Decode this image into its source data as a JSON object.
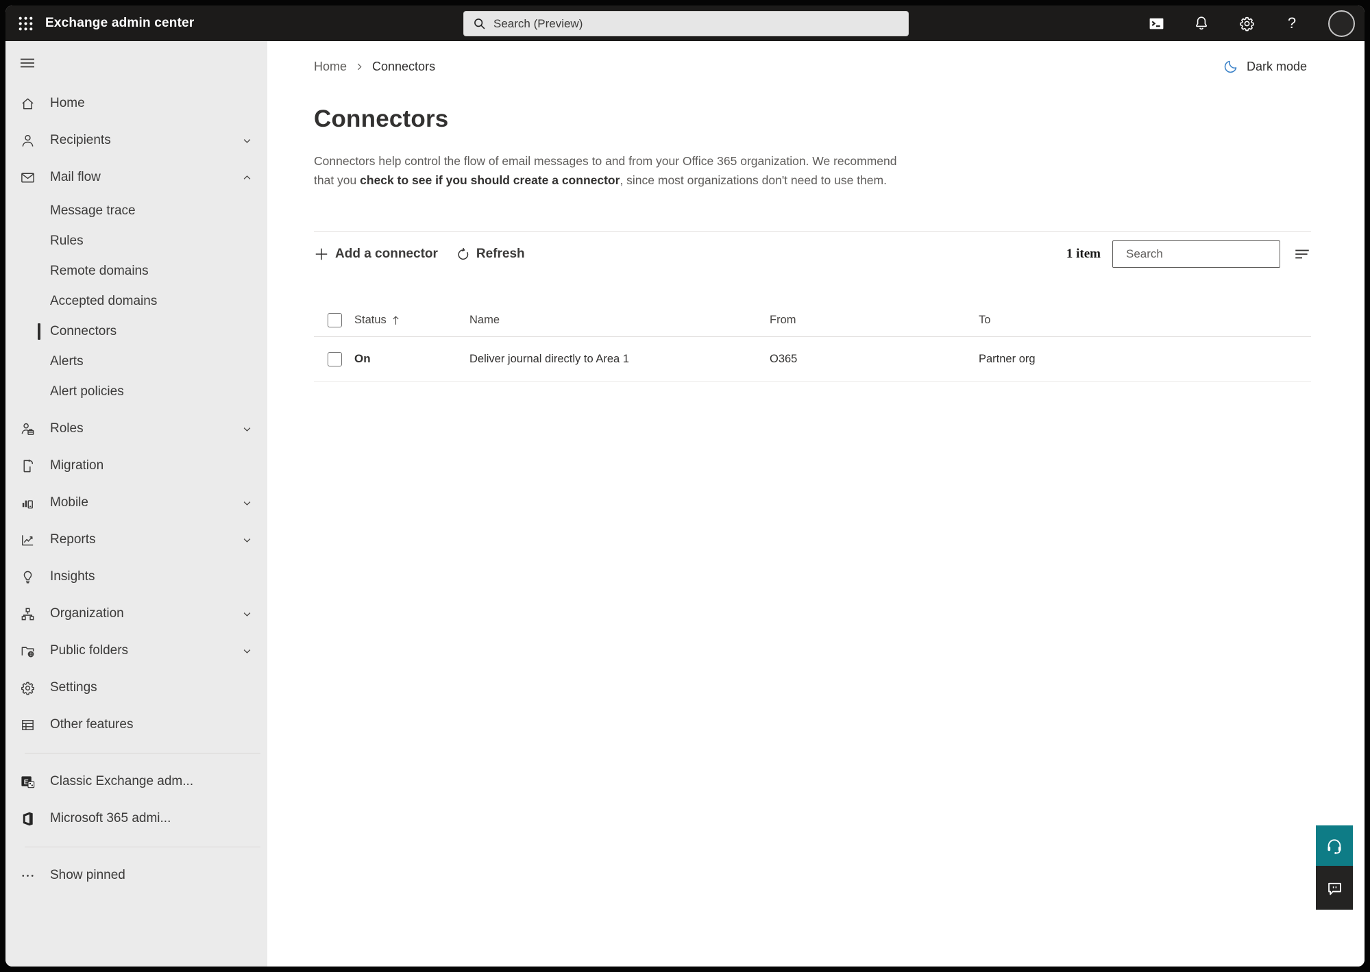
{
  "topbar": {
    "title": "Exchange admin center",
    "search_placeholder": "Search (Preview)"
  },
  "breadcrumb": {
    "home": "Home",
    "current": "Connectors"
  },
  "dark_mode_label": "Dark mode",
  "sidebar": {
    "items": [
      {
        "label": "Home"
      },
      {
        "label": "Recipients"
      },
      {
        "label": "Mail flow"
      },
      {
        "label": "Message trace"
      },
      {
        "label": "Rules"
      },
      {
        "label": "Remote domains"
      },
      {
        "label": "Accepted domains"
      },
      {
        "label": "Connectors"
      },
      {
        "label": "Alerts"
      },
      {
        "label": "Alert policies"
      },
      {
        "label": "Roles"
      },
      {
        "label": "Migration"
      },
      {
        "label": "Mobile"
      },
      {
        "label": "Reports"
      },
      {
        "label": "Insights"
      },
      {
        "label": "Organization"
      },
      {
        "label": "Public folders"
      },
      {
        "label": "Settings"
      },
      {
        "label": "Other features"
      },
      {
        "label": "Classic Exchange adm..."
      },
      {
        "label": "Microsoft 365 admi..."
      },
      {
        "label": "Show pinned"
      }
    ]
  },
  "page": {
    "title": "Connectors",
    "description_1": "Connectors help control the flow of email messages to and from your Office 365 organization. We recommend that you ",
    "description_link": "check to see if you should create a connector",
    "description_2": ", since most organizations don't need to use them."
  },
  "toolbar": {
    "add_label": "Add a connector",
    "refresh_label": "Refresh",
    "item_count": "1 item",
    "search_placeholder": "Search"
  },
  "table": {
    "headers": [
      "Status",
      "Name",
      "From",
      "To"
    ],
    "rows": [
      {
        "status": "On",
        "name": "Deliver journal directly to Area 1",
        "from": "O365",
        "to": "Partner org"
      }
    ]
  },
  "colors": {
    "topbar_bg": "#1c1b1a",
    "sidebar_bg": "#ebebeb",
    "accent_moon": "#3b82c8",
    "support_teal": "#0e7c86",
    "feedback_dark": "#242322"
  }
}
